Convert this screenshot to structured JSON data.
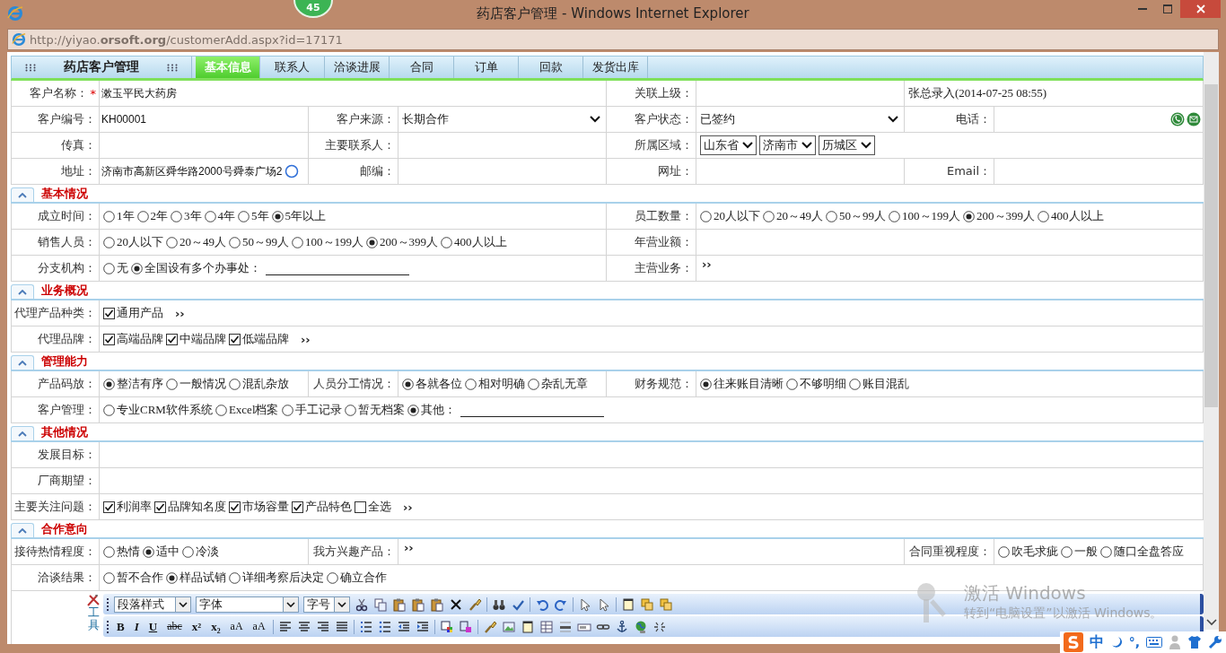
{
  "window": {
    "title": "药店客户管理 - Windows Internet Explorer",
    "badge": "45"
  },
  "address_bar": {
    "url": "http://yiyao.**orsoft.org**/customerAdd.aspx?id=17171"
  },
  "module": {
    "title": "药店客户管理"
  },
  "tabs": [
    {
      "label": "基本信息",
      "selected": true
    },
    {
      "label": "联系人",
      "selected": false
    },
    {
      "label": "洽谈进展",
      "selected": false
    },
    {
      "label": "合同",
      "selected": false
    },
    {
      "label": "订单",
      "selected": false
    },
    {
      "label": "回款",
      "selected": false
    },
    {
      "label": "发货出库",
      "selected": false
    }
  ],
  "top_rows": [
    [
      {
        "label": "客户名称：",
        "mark": "*",
        "kind": "text",
        "value": "漱玉平民大药房"
      },
      {
        "label": "关联上级：",
        "kind": "text"
      },
      {
        "kind": "note",
        "text": "张总录入(2014-07-25 08:55)"
      }
    ],
    [
      {
        "label": "客户编号：",
        "kind": "text",
        "value": "KH00001"
      },
      {
        "label": "客户来源：",
        "kind": "select",
        "value": "长期合作"
      },
      {
        "label": "客户状态：",
        "kind": "select",
        "value": "已签约"
      },
      {
        "label": "电话：",
        "kind": "text",
        "contact_icons": true
      }
    ],
    [
      {
        "label": "传真：",
        "kind": "text"
      },
      {
        "label": "主要联系人：",
        "kind": "text"
      },
      {
        "label": "所属区域：",
        "kind": "selects",
        "values": [
          "山东省",
          "济南市",
          "历城区"
        ]
      }
    ],
    [
      {
        "label": "地址：",
        "kind": "text",
        "value": "济南市高新区舜华路2000号舜泰广场2",
        "accelerator": true
      },
      {
        "label": "邮编：",
        "kind": "text"
      },
      {
        "label": "网址：",
        "kind": "text"
      },
      {
        "label": "Email：",
        "kind": "text"
      }
    ]
  ],
  "sections": [
    {
      "title": "基本情况",
      "expanded": true,
      "rows": [
        [
          {
            "label": "成立时间：",
            "kind": "radios",
            "options": [
              {
                "label": "1年",
                "selected": false
              },
              {
                "label": "2年",
                "selected": false
              },
              {
                "label": "3年",
                "selected": false
              },
              {
                "label": "4年",
                "selected": false
              },
              {
                "label": "5年",
                "selected": false
              },
              {
                "label": "5年以上",
                "selected": true
              }
            ]
          },
          {
            "label": "员工数量：",
            "kind": "radios",
            "options": [
              {
                "label": "20人以下",
                "selected": false
              },
              {
                "label": "20～49人",
                "selected": false
              },
              {
                "label": "50～99人",
                "selected": false
              },
              {
                "label": "100～199人",
                "selected": false
              },
              {
                "label": "200～399人",
                "selected": true
              },
              {
                "label": "400人以上",
                "selected": false
              }
            ]
          }
        ],
        [
          {
            "label": "销售人员：",
            "kind": "radios",
            "options": [
              {
                "label": "20人以下",
                "selected": false
              },
              {
                "label": "20～49人",
                "selected": false
              },
              {
                "label": "50～99人",
                "selected": false
              },
              {
                "label": "100～199人",
                "selected": false
              },
              {
                "label": "200～399人",
                "selected": true
              },
              {
                "label": "400人以上",
                "selected": false
              }
            ]
          },
          {
            "label": "年营业额：",
            "kind": "text"
          }
        ],
        [
          {
            "label": "分支机构：",
            "kind": "radios",
            "blank": true,
            "options": [
              {
                "label": "无",
                "selected": false
              },
              {
                "label": "全国设有多个办事处：",
                "selected": true
              }
            ]
          },
          {
            "label": "主营业务：",
            "kind": "more",
            "more": "››"
          }
        ]
      ]
    },
    {
      "title": "业务概况",
      "expanded": true,
      "rows": [
        [
          {
            "label": "代理产品种类：",
            "kind": "checks",
            "more": "››",
            "options": [
              {
                "label": "通用产品",
                "checked": true
              }
            ]
          }
        ],
        [
          {
            "label": "代理品牌：",
            "kind": "checks",
            "more": "››",
            "options": [
              {
                "label": "高端品牌",
                "checked": true
              },
              {
                "label": "中端品牌",
                "checked": true
              },
              {
                "label": "低端品牌",
                "checked": true
              }
            ]
          }
        ]
      ]
    },
    {
      "title": "管理能力",
      "expanded": true,
      "rows": [
        [
          {
            "label": "产品码放：",
            "kind": "radios",
            "options": [
              {
                "label": "整洁有序",
                "selected": true
              },
              {
                "label": "一般情况",
                "selected": false
              },
              {
                "label": "混乱杂放",
                "selected": false
              }
            ]
          },
          {
            "label": "人员分工情况：",
            "kind": "radios",
            "options": [
              {
                "label": "各就各位",
                "selected": true
              },
              {
                "label": "相对明确",
                "selected": false
              },
              {
                "label": "杂乱无章",
                "selected": false
              }
            ]
          },
          {
            "label": "财务规范：",
            "kind": "radios",
            "options": [
              {
                "label": "往来账目清晰",
                "selected": true
              },
              {
                "label": "不够明细",
                "selected": false
              },
              {
                "label": "账目混乱",
                "selected": false
              }
            ]
          }
        ],
        [
          {
            "label": "客户管理：",
            "kind": "radios",
            "blank": true,
            "options": [
              {
                "label": "专业CRM软件系统",
                "selected": false
              },
              {
                "label": "Excel档案",
                "selected": false
              },
              {
                "label": "手工记录",
                "selected": false
              },
              {
                "label": "暂无档案",
                "selected": false
              },
              {
                "label": "其他：",
                "selected": true
              }
            ]
          }
        ]
      ]
    },
    {
      "title": "其他情况",
      "expanded": true,
      "rows": [
        [
          {
            "label": "发展目标：",
            "kind": "text"
          }
        ],
        [
          {
            "label": "厂商期望：",
            "kind": "text"
          }
        ],
        [
          {
            "label": "主要关注问题：",
            "kind": "checks",
            "more": "››",
            "options": [
              {
                "label": "利润率",
                "checked": true
              },
              {
                "label": "品牌知名度",
                "checked": true
              },
              {
                "label": "市场容量",
                "checked": true
              },
              {
                "label": "产品特色",
                "checked": true
              },
              {
                "label": "全选",
                "checked": false
              }
            ]
          }
        ]
      ]
    },
    {
      "title": "合作意向",
      "expanded": true,
      "rows": [
        [
          {
            "label": "接待热情程度：",
            "kind": "radios",
            "options": [
              {
                "label": "热情",
                "selected": false
              },
              {
                "label": "适中",
                "selected": true
              },
              {
                "label": "冷淡",
                "selected": false
              }
            ]
          },
          {
            "label": "我方兴趣产品：",
            "kind": "more",
            "more": "››"
          },
          {
            "label": "合同重视程度：",
            "kind": "radios",
            "options": [
              {
                "label": "吹毛求疵",
                "selected": false
              },
              {
                "label": "一般",
                "selected": false
              },
              {
                "label": "随口全盘答应",
                "selected": false
              }
            ]
          }
        ],
        [
          {
            "label": "洽谈结果：",
            "kind": "radios",
            "options": [
              {
                "label": "暂不合作",
                "selected": false
              },
              {
                "label": "样品试销",
                "selected": true
              },
              {
                "label": "详细考察后决定",
                "selected": false
              },
              {
                "label": "确立合作",
                "selected": false
              }
            ]
          }
        ]
      ]
    }
  ],
  "editor": {
    "label": "工具",
    "selects": [
      "段落样式",
      "字体",
      "字号"
    ],
    "format_buttons": [
      "B",
      "I",
      "U",
      "abc",
      "x²",
      "x₂",
      "aA",
      "aA"
    ]
  },
  "activation_notice": {
    "title": "激活 Windows",
    "text": "转到“电脑设置”以激活 Windows。"
  },
  "ime_bar": {
    "mode": "中",
    "punctuation": "°,"
  }
}
